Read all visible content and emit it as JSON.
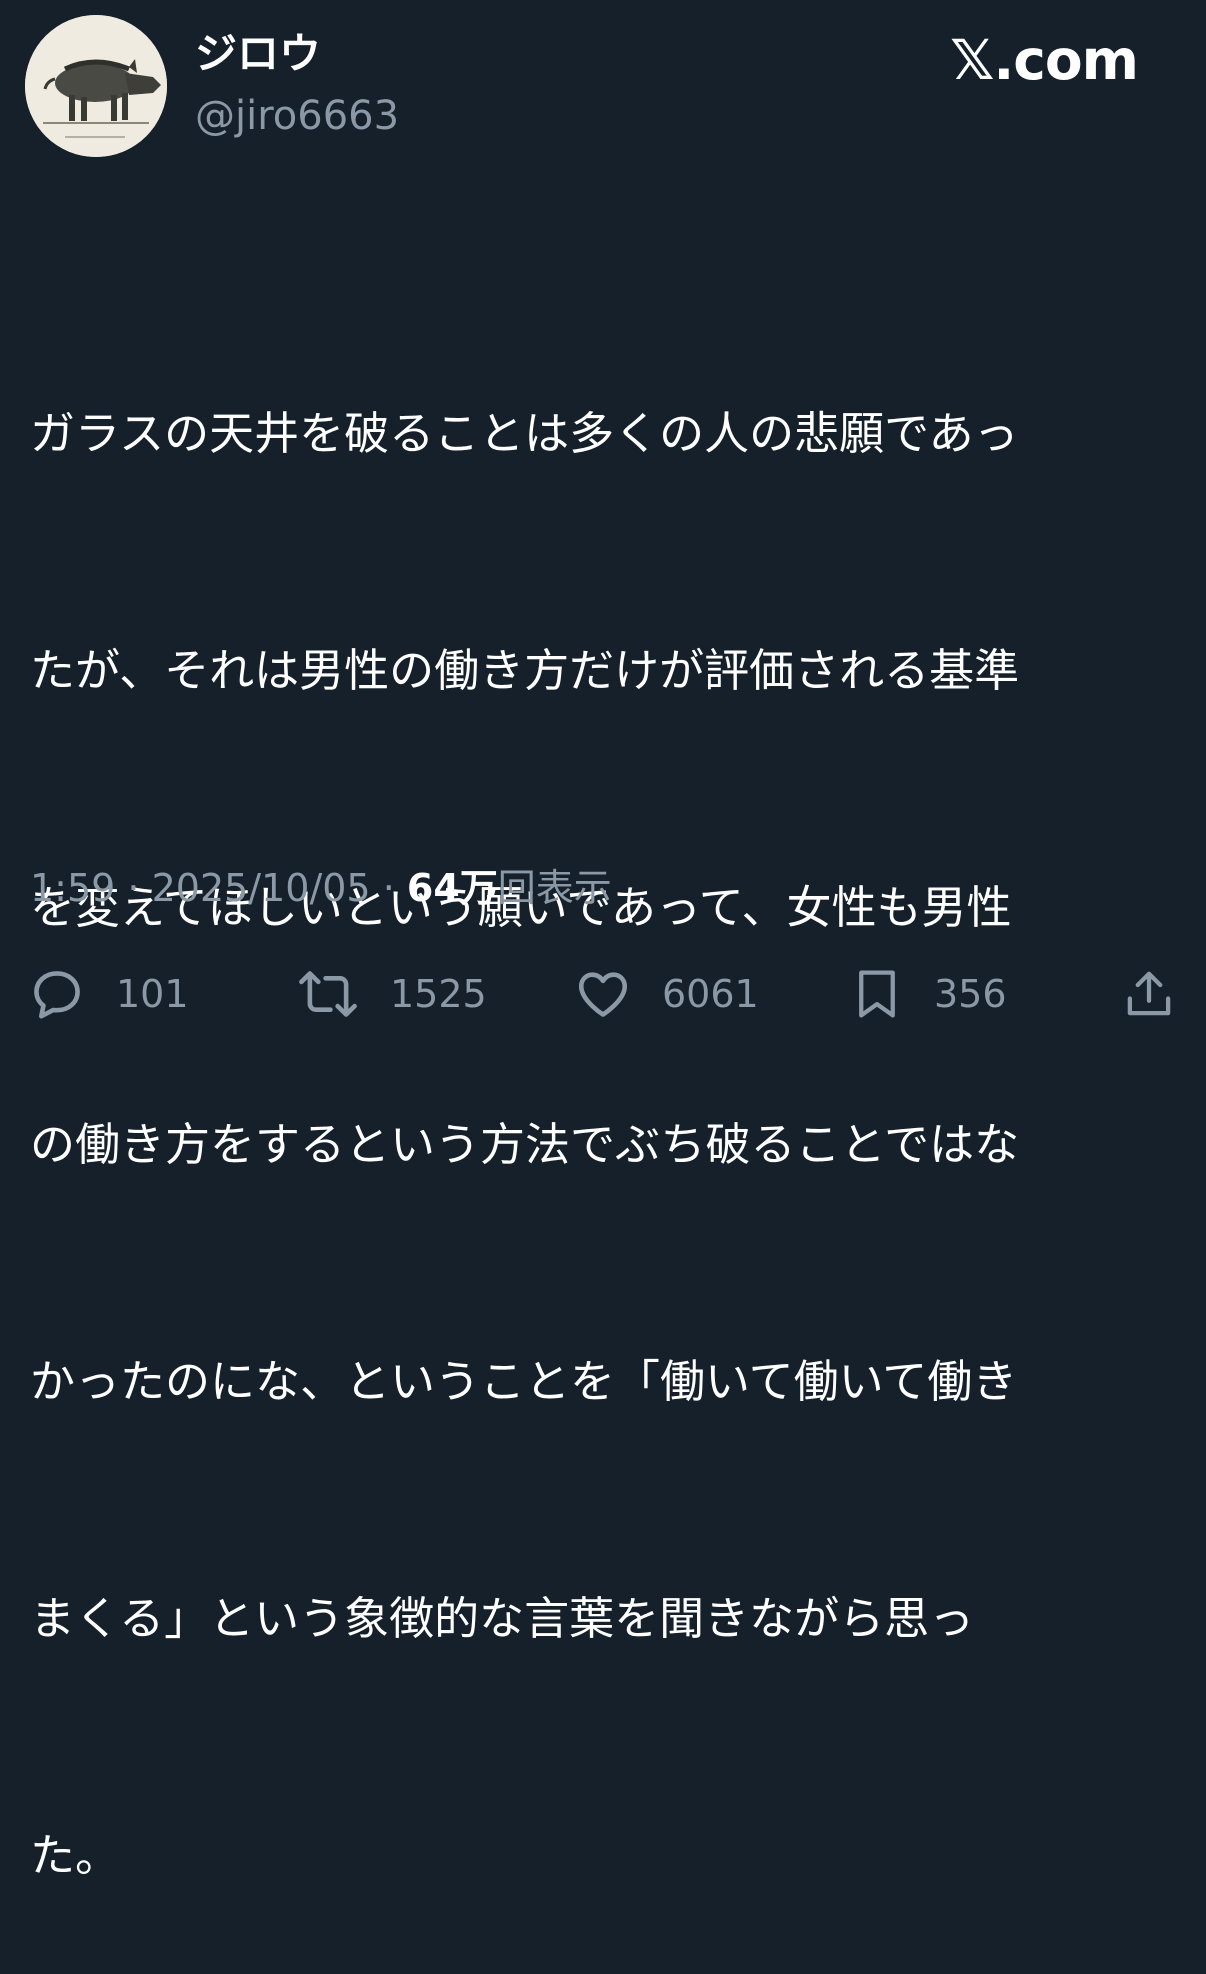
{
  "author": {
    "display_name": "ジロウ",
    "handle": "@jiro6663",
    "avatar_icon": "boar-avatar"
  },
  "brand": {
    "label": "𝕏.com"
  },
  "tweet": {
    "lines": [
      "ガラスの天井を破ることは多くの人の悲願であっ",
      "たが、それは男性の働き方だけが評価される基準",
      "を変えてほしいという願いであって、女性も男性",
      "の働き方をするという方法でぶち破ることではな",
      "かったのにな、ということを「働いて働いて働き",
      "まくる」という象徴的な言葉を聞きながら思っ",
      "た。"
    ]
  },
  "meta": {
    "time": "1:59",
    "date": "2025/10/05",
    "separator": " · ",
    "views_count": "64万",
    "views_label": "回表示"
  },
  "actions": {
    "reply": {
      "icon": "reply-icon",
      "count": "101"
    },
    "retweet": {
      "icon": "retweet-icon",
      "count": "1525"
    },
    "like": {
      "icon": "heart-icon",
      "count": "6061"
    },
    "bookmark": {
      "icon": "bookmark-icon",
      "count": "356"
    },
    "share": {
      "icon": "share-icon"
    }
  },
  "colors": {
    "background": "#15202b",
    "text_primary": "#ffffff",
    "text_secondary": "#8b98a5"
  }
}
